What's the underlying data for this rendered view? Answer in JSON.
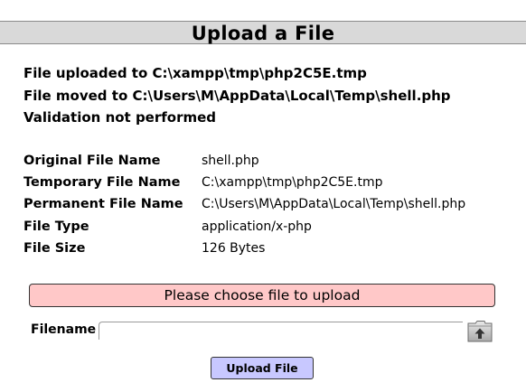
{
  "page": {
    "title": "Upload a File"
  },
  "status": {
    "uploaded": "File uploaded to C:\\xampp\\tmp\\php2C5E.tmp",
    "moved": "File moved to C:\\Users\\M\\AppData\\Local\\Temp\\shell.php",
    "validation": "Validation not performed"
  },
  "details": [
    {
      "label": "Original File Name",
      "value": "shell.php"
    },
    {
      "label": "Temporary File Name",
      "value": "C:\\xampp\\tmp\\php2C5E.tmp"
    },
    {
      "label": "Permanent File Name",
      "value": "C:\\Users\\M\\AppData\\Local\\Temp\\shell.php"
    },
    {
      "label": "File Type",
      "value": "application/x-php"
    },
    {
      "label": "File Size",
      "value": "126 Bytes"
    }
  ],
  "notice": {
    "text": "Please choose file to upload",
    "color": "#ffc8c8"
  },
  "form": {
    "filename_label": "Filename",
    "filename_value": "",
    "browse_icon": "folder-upload-icon",
    "upload_label": "Upload File",
    "upload_color": "#c8c8ff"
  }
}
